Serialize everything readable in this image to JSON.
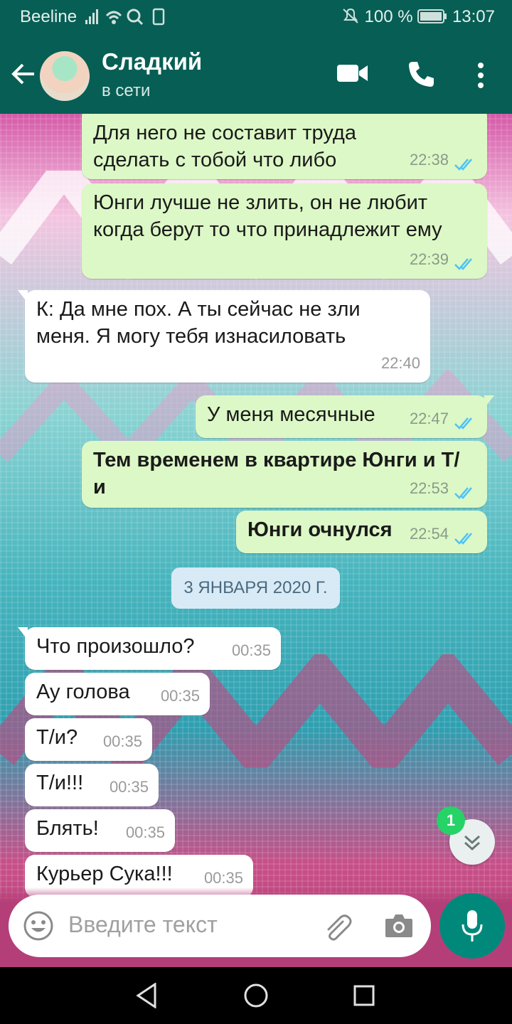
{
  "status_bar": {
    "carrier": "Beeline",
    "battery": "100 %",
    "time": "13:07"
  },
  "header": {
    "contact_name": "Сладкий",
    "status": "в сети"
  },
  "messages": [
    {
      "text": "Для него не составит труда сделать с тобой что либо",
      "time": "22:38"
    },
    {
      "text": "Юнги лучше не злить, он не любит когда берут то что принадлежит ему",
      "time": "22:39"
    },
    {
      "text": "К: Да мне пох. А ты сейчас не зли меня. Я могу тебя изнасиловать",
      "time": "22:40"
    },
    {
      "text": "У меня месячные",
      "time": "22:47"
    },
    {
      "text": "Тем временем в квартире Юнги и Т/и",
      "time": "22:53"
    },
    {
      "text": "Юнги очнулся",
      "time": "22:54"
    },
    {
      "text": "Что произошло?",
      "time": "00:35"
    },
    {
      "text": "Ау голова",
      "time": "00:35"
    },
    {
      "text": "Т/и?",
      "time": "00:35"
    },
    {
      "text": "Т/и!!!",
      "time": "00:35"
    },
    {
      "text": "Блять!",
      "time": "00:35"
    },
    {
      "text": "Курьер Сука!!!",
      "time": "00:35"
    }
  ],
  "date_chip": "3 ЯНВАРЯ 2020 Г.",
  "unread_badge": "1",
  "composer": {
    "placeholder": "Введите текст"
  },
  "colors": {
    "header": "#075e54",
    "outgoing": "#dcf8c6",
    "incoming": "#ffffff",
    "ticks": "#4fc3f7",
    "mic": "#00897b"
  }
}
